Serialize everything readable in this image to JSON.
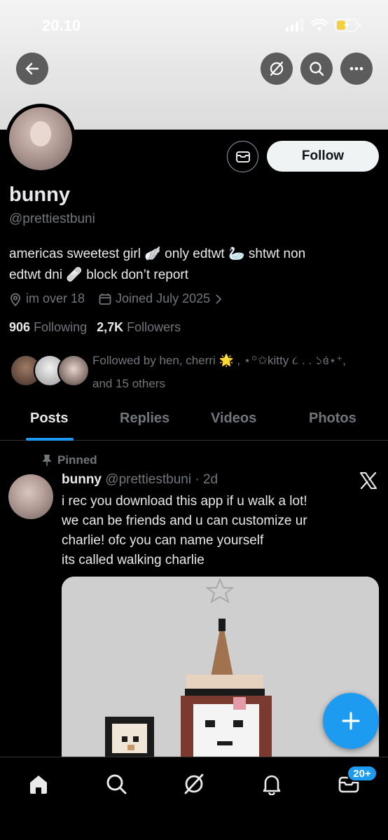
{
  "status_bar": {
    "time": "20.10"
  },
  "header": {
    "icons": [
      "back-arrow-icon",
      "grok-icon",
      "search-icon",
      "more-icon"
    ]
  },
  "profile": {
    "name": "bunny",
    "handle": "@prettiestbuni",
    "bio_line1": "americas sweetest girl 🪽 only edtwt 🦢 shtwt non",
    "bio_line2": "edtwt dni 🩹 block don’t report",
    "location": "im over 18",
    "joined": "Joined July 2025",
    "following_count": "906",
    "following_label": "Following",
    "followers_count": "2,7K",
    "followers_label": "Followers",
    "followed_by_line1": "Followed by hen, cherri 🌟 , ⋆꙳✩kitty ૮ . . ১ɞ̇⋆⁺,",
    "followed_by_line2": "and 15 others",
    "follow_button": "Follow"
  },
  "tabs": [
    "Posts",
    "Replies",
    "Videos",
    "Photos"
  ],
  "active_tab": "Posts",
  "post": {
    "pinned_label": "Pinned",
    "author": "bunny",
    "handle": "@prettiestbuni",
    "time": "· 2d",
    "text_lines": [
      "i rec you download this app if u walk a lot!",
      "we can be friends and u can customize ur",
      "charlie! ofc you can name yourself",
      "its called walking charlie"
    ]
  },
  "notifications_badge": "20+",
  "colors": {
    "accent": "#1d9bf0",
    "background": "#000000",
    "muted": "#71767b"
  }
}
